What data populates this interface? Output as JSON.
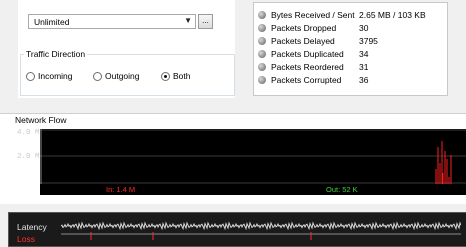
{
  "bandwidth": {
    "selected": "Unlimited",
    "more_label": "..."
  },
  "traffic_direction": {
    "title": "Traffic Direction",
    "options": [
      {
        "label": "Incoming",
        "checked": false
      },
      {
        "label": "Outgoing",
        "checked": false
      },
      {
        "label": "Both",
        "checked": true
      }
    ]
  },
  "stats": [
    {
      "label": "Bytes Received / Sent",
      "value": "2.65 MB / 103 KB"
    },
    {
      "label": "Packets Dropped",
      "value": "30"
    },
    {
      "label": "Packets Delayed",
      "value": "3795"
    },
    {
      "label": "Packets Duplicated",
      "value": "34"
    },
    {
      "label": "Packets Reordered",
      "value": "31"
    },
    {
      "label": "Packets Corrupted",
      "value": "36"
    }
  ],
  "network_flow": {
    "title": "Network Flow",
    "y_labels": [
      "4.0 M",
      "2.0 M"
    ],
    "in_label": "In: 1.4 M",
    "out_label": "Out: 52 K",
    "colors": {
      "in": "#ff2020",
      "out": "#3fd13f",
      "grid": "#3a3a3a"
    }
  },
  "latency": {
    "label": "Latency",
    "sub_label": "Loss"
  }
}
